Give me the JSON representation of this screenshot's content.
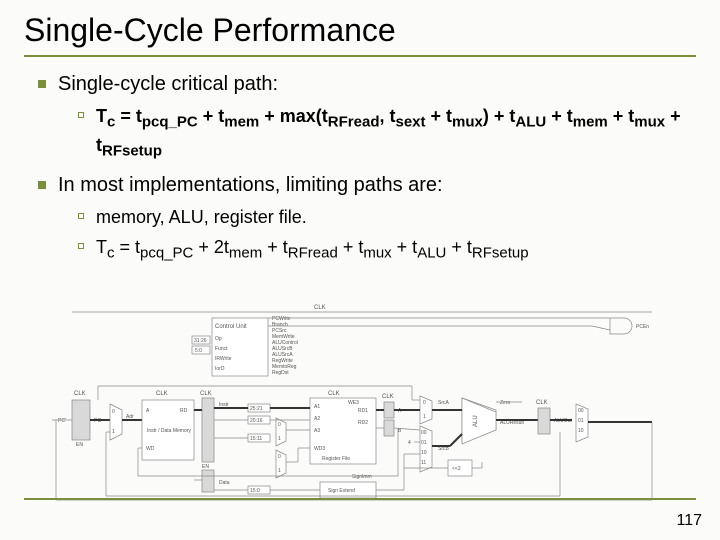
{
  "title": "Single-Cycle Performance",
  "page_number": "117",
  "bullets": {
    "b1": "Single-cycle critical path:",
    "b1a_html": "T<sub>c</sub> = t<sub>pcq_PC</sub> + t<sub>mem</sub> + max(t<sub>RFread</sub>, t<sub>sext</sub> + t<sub>mux</sub>) + t<sub>ALU</sub> + t<sub>mem</sub> + t<sub>mux</sub> + t<sub>RFsetup</sub>",
    "b2": "In most implementations, limiting paths are:",
    "b2a": "memory, ALU, register file.",
    "b2b_html": "T<sub>c</sub> = t<sub>pcq_PC</sub> + 2t<sub>mem</sub> + t<sub>RFread</sub> + t<sub>mux</sub> + t<sub>ALU</sub> + t<sub>RFsetup</sub>"
  },
  "diagram_labels": {
    "clk": "CLK",
    "control_unit": "Control Unit",
    "pcwrite": "PCWrite",
    "ir_write": "IRWrite",
    "branch": "Branch",
    "pcsrc": "PCSrc",
    "memwrite": "MemWrite",
    "alucontrol": "ALUControl",
    "alusrcb": "ALUSrcB",
    "alusrca": "ALUSrcA",
    "regwrite": "RegWrite",
    "iord": "IorD",
    "memr": "MemtoReg",
    "regdst": "RegDst",
    "pc": "PC",
    "pcprime": "PC'",
    "adr": "Adr",
    "a": "A",
    "rd": "RD",
    "wd": "WD",
    "em": "EN",
    "instr_data_mem": "Instr / Data Memory",
    "instr": "Instr",
    "data": "Data",
    "a1": "A1",
    "a2": "A2",
    "a3": "A3",
    "we3": "WE3",
    "wd3": "WD3",
    "rd1": "RD1",
    "rd2": "RD2",
    "regfile": "Register File",
    "srca": "SrcA",
    "srcb": "SrcB",
    "alu": "ALU",
    "zero": "Zero",
    "aluresult": "ALUResult",
    "aluout": "ALUOut",
    "shl2": "<<2",
    "signimm": "SignImm",
    "signextend": "Sign Extend",
    "bits31_26": "31:26",
    "bits5_0": "5:0",
    "bits25_21": "25:21",
    "bits20_16": "20:16",
    "bits15_11": "15:11",
    "bits15_0": "15:0",
    "const4": "4",
    "pcen": "PCEn",
    "op": "Op",
    "funct": "Funct",
    "b": "B",
    "b_out": "B",
    "num0": "0",
    "num1": "1",
    "num00": "00",
    "num01": "01",
    "num10": "10",
    "num11": "11"
  }
}
